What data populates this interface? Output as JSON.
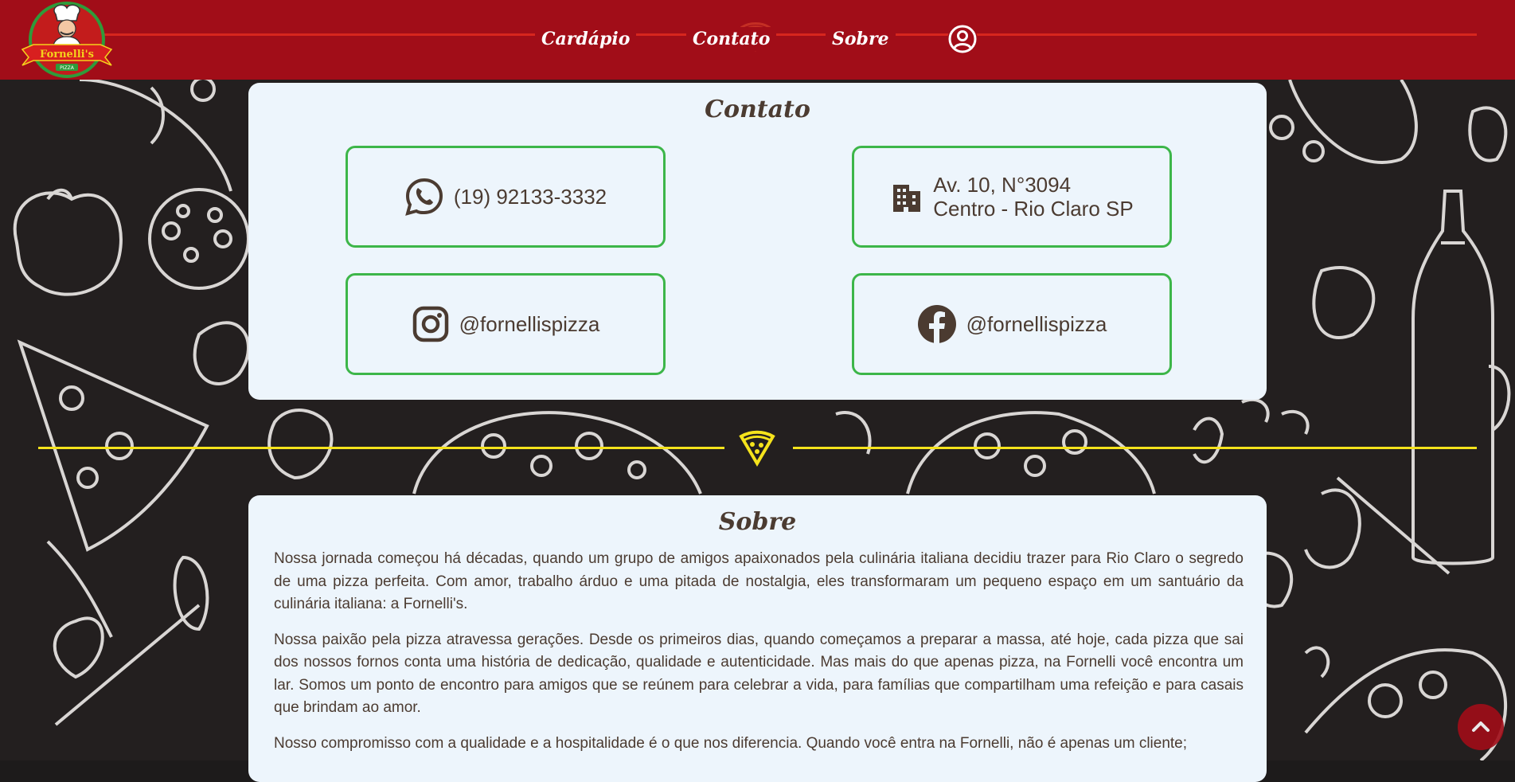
{
  "brand": {
    "logo_text": "Fornelli's",
    "logo_subtext": "PIZZA"
  },
  "nav": {
    "items": [
      {
        "label": "Cardápio"
      },
      {
        "label": "Contato"
      },
      {
        "label": "Sobre"
      }
    ],
    "user_icon": "user-circle-icon",
    "pizza_icon": "pizza-slice-icon"
  },
  "contact": {
    "title": "Contato",
    "phone": {
      "icon": "whatsapp-icon",
      "text": "(19) 92133-3332"
    },
    "address": {
      "icon": "building-icon",
      "line1": "Av. 10, N°3094",
      "line2": "Centro - Rio Claro SP"
    },
    "instagram": {
      "icon": "instagram-icon",
      "text": "@fornellispizza"
    },
    "facebook": {
      "icon": "facebook-icon",
      "text": "@fornellispizza"
    }
  },
  "about": {
    "title": "Sobre",
    "paragraphs": [
      "Nossa jornada começou há décadas, quando um grupo de amigos apaixonados pela culinária italiana decidiu trazer para Rio Claro o segredo de uma pizza perfeita. Com amor, trabalho árduo e uma pitada de nostalgia, eles transformaram um pequeno espaço em um santuário da culinária italiana: a Fornelli's.",
      "Nossa paixão pela pizza atravessa gerações. Desde os primeiros dias, quando começamos a preparar a massa, até hoje, cada pizza que sai dos nossos fornos conta uma história de dedicação, qualidade e autenticidade. Mas mais do que apenas pizza, na Fornelli você encontra um lar. Somos um ponto de encontro para amigos que se reúnem para celebrar a vida, para famílias que compartilham uma refeição e para casais que brindam ao amor.",
      "Nosso compromisso com a qualidade e a hospitalidade é o que nos diferencia. Quando você entra na Fornelli, não é apenas um cliente;"
    ]
  },
  "colors": {
    "header": "#a10d18",
    "card_bg": "#edf5fc",
    "accent_green": "#3db649",
    "accent_yellow": "#f5e31c",
    "text_brown": "#4b3b31"
  },
  "scroll_top_icon": "chevron-up-icon"
}
